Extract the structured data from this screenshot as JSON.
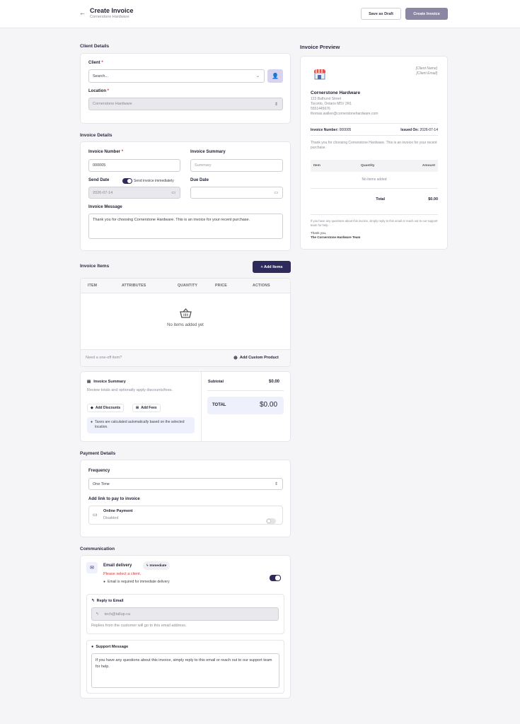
{
  "header": {
    "title": "Create Invoice",
    "subtitle": "Cornerstone Hardware",
    "draft_label": "Save as Draft",
    "create_label": "Create Invoice"
  },
  "client": {
    "section": "Client Details",
    "client_label": "Client",
    "client_placeholder": "Search...",
    "location_label": "Location",
    "location_value": "Cornerstone Hardware",
    "required": "*"
  },
  "details": {
    "section": "Invoice Details",
    "number_label": "Invoice Number",
    "number_value": "000005",
    "summary_label": "Invoice Summary",
    "summary_placeholder": "Summary",
    "send_label": "Send Date",
    "send_immediately": "Send invoice immediately",
    "send_value": "2026-07-14",
    "due_label": "Due Date",
    "message_label": "Invoice Message",
    "message_value": "Thank you for choosing Cornerstone Hardware. This is an invoice for your recent purchase."
  },
  "items": {
    "section": "Invoice Items",
    "add_label": "+ Add Items",
    "columns": [
      "ITEM",
      "ATTRIBUTES",
      "QUANTITY",
      "PRICE",
      "ACTIONS"
    ],
    "empty": "No items added yet",
    "custom_prompt": "Need a one-off item?",
    "custom_label": "Add Custom Product"
  },
  "summary": {
    "title": "Invoice Summary",
    "desc": "Review totals and optionally apply discounts/fees.",
    "discounts": "Add Discounts",
    "fees": "Add Fees",
    "tax_note": "Taxes are calculated automatically based on the selected location.",
    "subtotal_label": "Subtotal",
    "subtotal_value": "$0.00",
    "total_label": "TOTAL",
    "total_value": "$0.00"
  },
  "payment": {
    "section": "Payment Details",
    "frequency_label": "Frequency",
    "frequency_value": "One Time",
    "link_label": "Add link to pay to invoice",
    "online_title": "Online Payment",
    "online_status": "Disabled"
  },
  "comm": {
    "section": "Communication",
    "email_title": "Email delivery",
    "badge": "Immediate",
    "error": "Please select a client.",
    "note": "Email is required for immediate delivery",
    "reply_title": "Reply to Email",
    "reply_value": "tech@tallup.ca",
    "reply_note": "Replies from the customer will go to this email address.",
    "support_title": "Support Message",
    "support_value": "If you have any questions about this invoice, simply reply to this email or reach out to our support team for help."
  },
  "preview": {
    "section": "Invoice Preview",
    "client_name": "[Client Name]",
    "client_email": "[Client Email]",
    "company": "Cornerstone Hardware",
    "address1": "123 Bathurst Street",
    "address2": "Toronto, Ontario M5V 2R1",
    "phone": "5551445676",
    "email": "thomas.walker@cornerstonehardware.com",
    "number_label": "Invoice Number:",
    "number_value": "000005",
    "issued_label": "Issued On:",
    "issued_value": "2026-07-14",
    "thanks": "Thank you for choosing Cornerstone Hardware. This is an invoice for your recent purchase.",
    "col_item": "Item",
    "col_qty": "Quantity",
    "col_amount": "Amount",
    "no_items": "No items added",
    "total_label": "Total",
    "total_value": "$0.00",
    "footer": "If you have any questions about this invoice, simply reply to this email or reach out to our support team for help.",
    "sign1": "Thank you,",
    "sign2": "The Cornerstone Hardware Team"
  },
  "colors": {
    "accent": "#2e2a5c",
    "error": "#d23b3b"
  }
}
